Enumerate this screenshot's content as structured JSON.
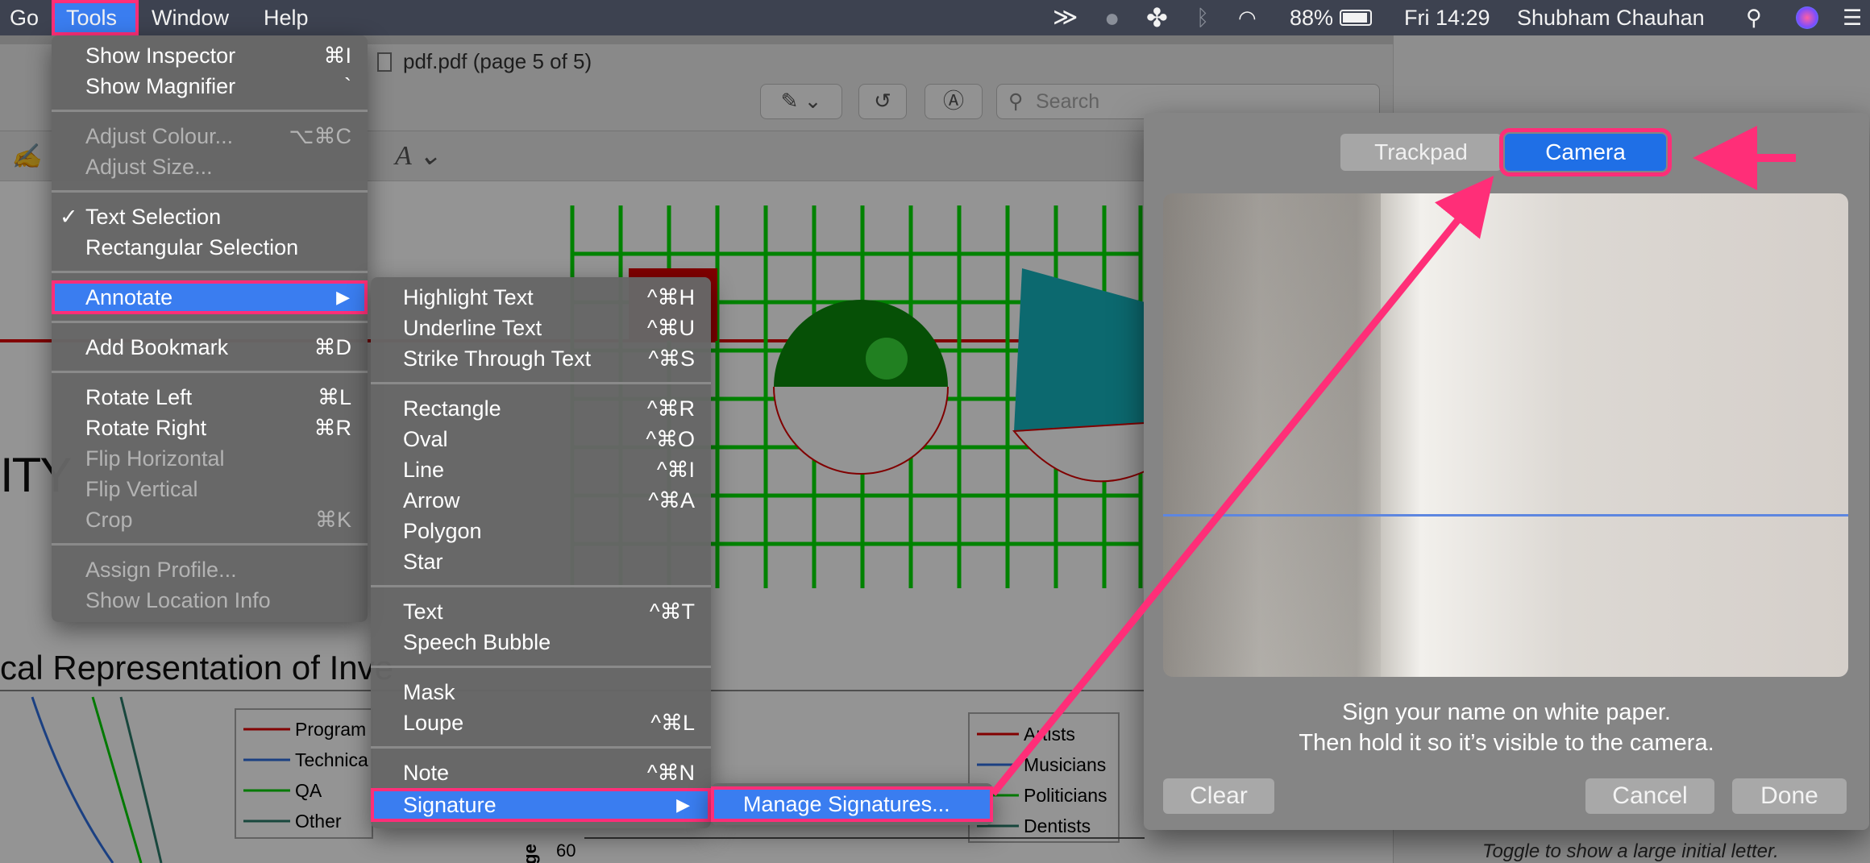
{
  "menubar": {
    "items": [
      "Go",
      "Tools",
      "Window",
      "Help"
    ],
    "battery": "88%",
    "clock": "Fri 14:29",
    "user": "Shubham Chauhan"
  },
  "window": {
    "title": "pdf.pdf (page 5 of 5)",
    "search_placeholder": "Search"
  },
  "background": {
    "ity": "ITY",
    "heading": "cal Representation of Inve",
    "legend_left": [
      "Program",
      "Technica",
      "QA",
      "Other"
    ],
    "legend_right": [
      "Artists",
      "Musicians",
      "Politicians",
      "Dentists"
    ],
    "axis_label": "ge",
    "axis_tick": "60",
    "panel_footer": "Toggle to show a large initial letter."
  },
  "tools_menu": {
    "items": [
      {
        "label": "Show Inspector",
        "shortcut": "⌘I"
      },
      {
        "label": "Show Magnifier",
        "shortcut": "`"
      },
      {
        "label": "Adjust Colour...",
        "shortcut": "⌥⌘C"
      },
      {
        "label": "Adjust Size..."
      },
      {
        "label": "Text Selection",
        "check": "✓"
      },
      {
        "label": "Rectangular Selection"
      },
      {
        "label": "Annotate"
      },
      {
        "label": "Add Bookmark",
        "shortcut": "⌘D"
      },
      {
        "label": "Rotate Left",
        "shortcut": "⌘L"
      },
      {
        "label": "Rotate Right",
        "shortcut": "⌘R"
      },
      {
        "label": "Flip Horizontal"
      },
      {
        "label": "Flip Vertical"
      },
      {
        "label": "Crop",
        "shortcut": "⌘K"
      },
      {
        "label": "Assign Profile..."
      },
      {
        "label": "Show Location Info"
      }
    ]
  },
  "annotate_menu": {
    "items": [
      {
        "label": "Highlight Text",
        "shortcut": "^⌘H"
      },
      {
        "label": "Underline Text",
        "shortcut": "^⌘U"
      },
      {
        "label": "Strike Through Text",
        "shortcut": "^⌘S"
      },
      {
        "label": "Rectangle",
        "shortcut": "^⌘R"
      },
      {
        "label": "Oval",
        "shortcut": "^⌘O"
      },
      {
        "label": "Line",
        "shortcut": "^⌘I"
      },
      {
        "label": "Arrow",
        "shortcut": "^⌘A"
      },
      {
        "label": "Polygon"
      },
      {
        "label": "Star"
      },
      {
        "label": "Text",
        "shortcut": "^⌘T"
      },
      {
        "label": "Speech Bubble"
      },
      {
        "label": "Mask"
      },
      {
        "label": "Loupe",
        "shortcut": "^⌘L"
      },
      {
        "label": "Note",
        "shortcut": "^⌘N"
      },
      {
        "label": "Signature"
      }
    ]
  },
  "signature_menu": {
    "manage": "Manage Signatures..."
  },
  "signature_panel": {
    "tabs": [
      "Trackpad",
      "Camera"
    ],
    "message_line1": "Sign your name on white paper.",
    "message_line2": "Then hold it so it’s visible to the camera.",
    "clear": "Clear",
    "cancel": "Cancel",
    "done": "Done"
  },
  "colors": {
    "highlight": "#3a7df0",
    "callout": "#ff2e78",
    "menubar": "#3d4250"
  }
}
